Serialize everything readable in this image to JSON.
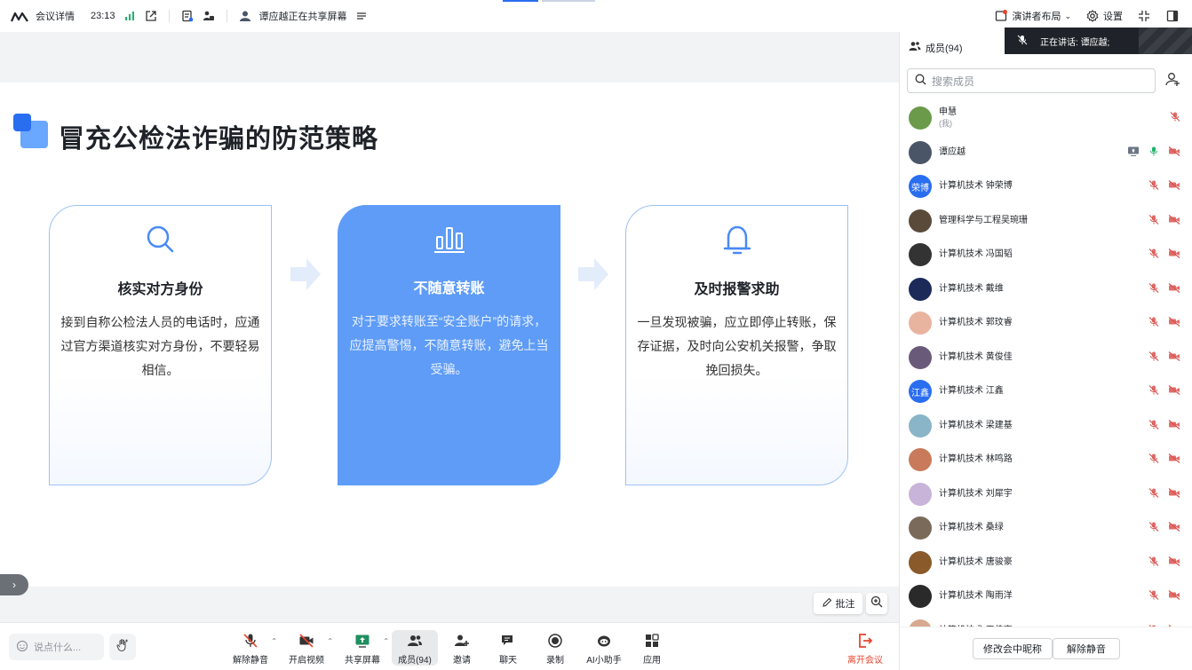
{
  "topbar": {
    "meeting_details": "会议详情",
    "time": "23:13",
    "sharing_text": "谭应越正在共享屏幕",
    "layout_label": "演讲者布局",
    "settings_label": "设置"
  },
  "slide": {
    "title": "冒充公检法诈骗的防范策略",
    "cards": [
      {
        "title": "核实对方身份",
        "body": "接到自称公检法人员的电话时，应通过官方渠道核实对方身份，不要轻易相信。"
      },
      {
        "title": "不随意转账",
        "body": "对于要求转账至“安全账户”的请求，应提高警惕，不随意转账，避免上当受骗。"
      },
      {
        "title": "及时报警求助",
        "body": "一旦发现被骗，应立即停止转账，保存证据，及时向公安机关报警，争取挽回损失。"
      }
    ]
  },
  "stage": {
    "annotate_label": "批注"
  },
  "bottombar": {
    "chat_placeholder": "说点什么...",
    "tools": [
      "解除静音",
      "开启视频",
      "共享屏幕",
      "成员(94)",
      "邀请",
      "聊天",
      "录制",
      "AI小助手",
      "应用"
    ],
    "leave_label": "离开会议"
  },
  "panel": {
    "title": "成员(94)",
    "speaking_label": "正在讲话:",
    "speaking_name": "谭应越;",
    "search_placeholder": "搜索成员",
    "members": [
      {
        "name": "申慧",
        "sub": "(我)",
        "avatar_color": "#6a9a4a",
        "avatar_text": ""
      },
      {
        "name": "谭应越",
        "sub": "",
        "avatar_color": "#4a5568",
        "avatar_text": ""
      },
      {
        "name": "计算机技术 钟荣博",
        "sub": "",
        "avatar_color": "#2a6ef0",
        "avatar_text": "荣博"
      },
      {
        "name": "管理科学与工程吴琬珊",
        "sub": "",
        "avatar_color": "#5a4a3a",
        "avatar_text": ""
      },
      {
        "name": "计算机技术  冯国韬",
        "sub": "",
        "avatar_color": "#333333",
        "avatar_text": ""
      },
      {
        "name": "计算机技术 戴维",
        "sub": "",
        "avatar_color": "#1c2a5a",
        "avatar_text": ""
      },
      {
        "name": "计算机技术 郭玟睿",
        "sub": "",
        "avatar_color": "#e8b4a0",
        "avatar_text": ""
      },
      {
        "name": "计算机技术 黄俊佳",
        "sub": "",
        "avatar_color": "#6a5a7a",
        "avatar_text": ""
      },
      {
        "name": "计算机技术 江鑫",
        "sub": "",
        "avatar_color": "#2a6ef0",
        "avatar_text": "江鑫"
      },
      {
        "name": "计算机技术 梁建基",
        "sub": "",
        "avatar_color": "#8ab4c8",
        "avatar_text": ""
      },
      {
        "name": "计算机技术 林鸣路",
        "sub": "",
        "avatar_color": "#c87a5a",
        "avatar_text": ""
      },
      {
        "name": "计算机技术 刘犀宇",
        "sub": "",
        "avatar_color": "#c8b4d8",
        "avatar_text": ""
      },
      {
        "name": "计算机技术 桑绿",
        "sub": "",
        "avatar_color": "#7a6a5a",
        "avatar_text": ""
      },
      {
        "name": "计算机技术 唐骏豪",
        "sub": "",
        "avatar_color": "#8a5a2a",
        "avatar_text": ""
      },
      {
        "name": "计算机技术 陶雨洋",
        "sub": "",
        "avatar_color": "#2a2a2a",
        "avatar_text": ""
      },
      {
        "name": "计算机技术 王佳奕",
        "sub": "",
        "avatar_color": "#d8a890",
        "avatar_text": ""
      }
    ],
    "rename_label": "修改会中昵称",
    "unmute_label": "解除静音"
  },
  "colors": {
    "accent": "#2a6ef0",
    "muted_red": "#e8442e"
  }
}
